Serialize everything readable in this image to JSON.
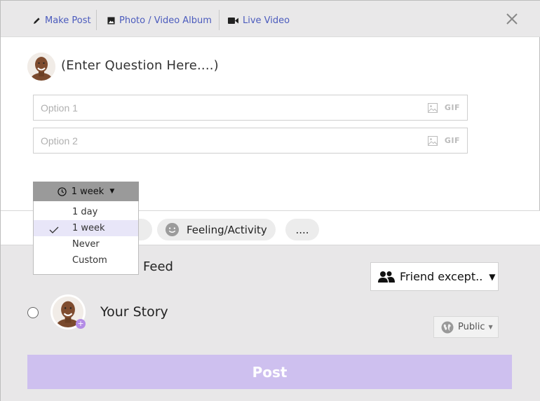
{
  "tabs": {
    "make_post": "Make Post",
    "photo_video_album": "Photo / Video Album",
    "live_video": "Live Video"
  },
  "question": {
    "placeholder": "(Enter Question Here....)"
  },
  "options": [
    {
      "placeholder": "Option 1",
      "gif": "GIF"
    },
    {
      "placeholder": "Option 2",
      "gif": "GIF"
    }
  ],
  "duration": {
    "selected": "1 week",
    "items": [
      "1 day",
      "1 week",
      "Never",
      "Custom"
    ]
  },
  "add_to_post": {
    "feeling_activity": "Feeling/Activity",
    "more": "...."
  },
  "audience": {
    "feed_label": "Feed",
    "friend_except": "Friend except..",
    "story_label": "Your Story",
    "public": "Public"
  },
  "post_button": "Post",
  "colors": {
    "accent": "#4b5bbd",
    "post_button": "#cec0ef",
    "selected_item": "#e8e6f8"
  }
}
